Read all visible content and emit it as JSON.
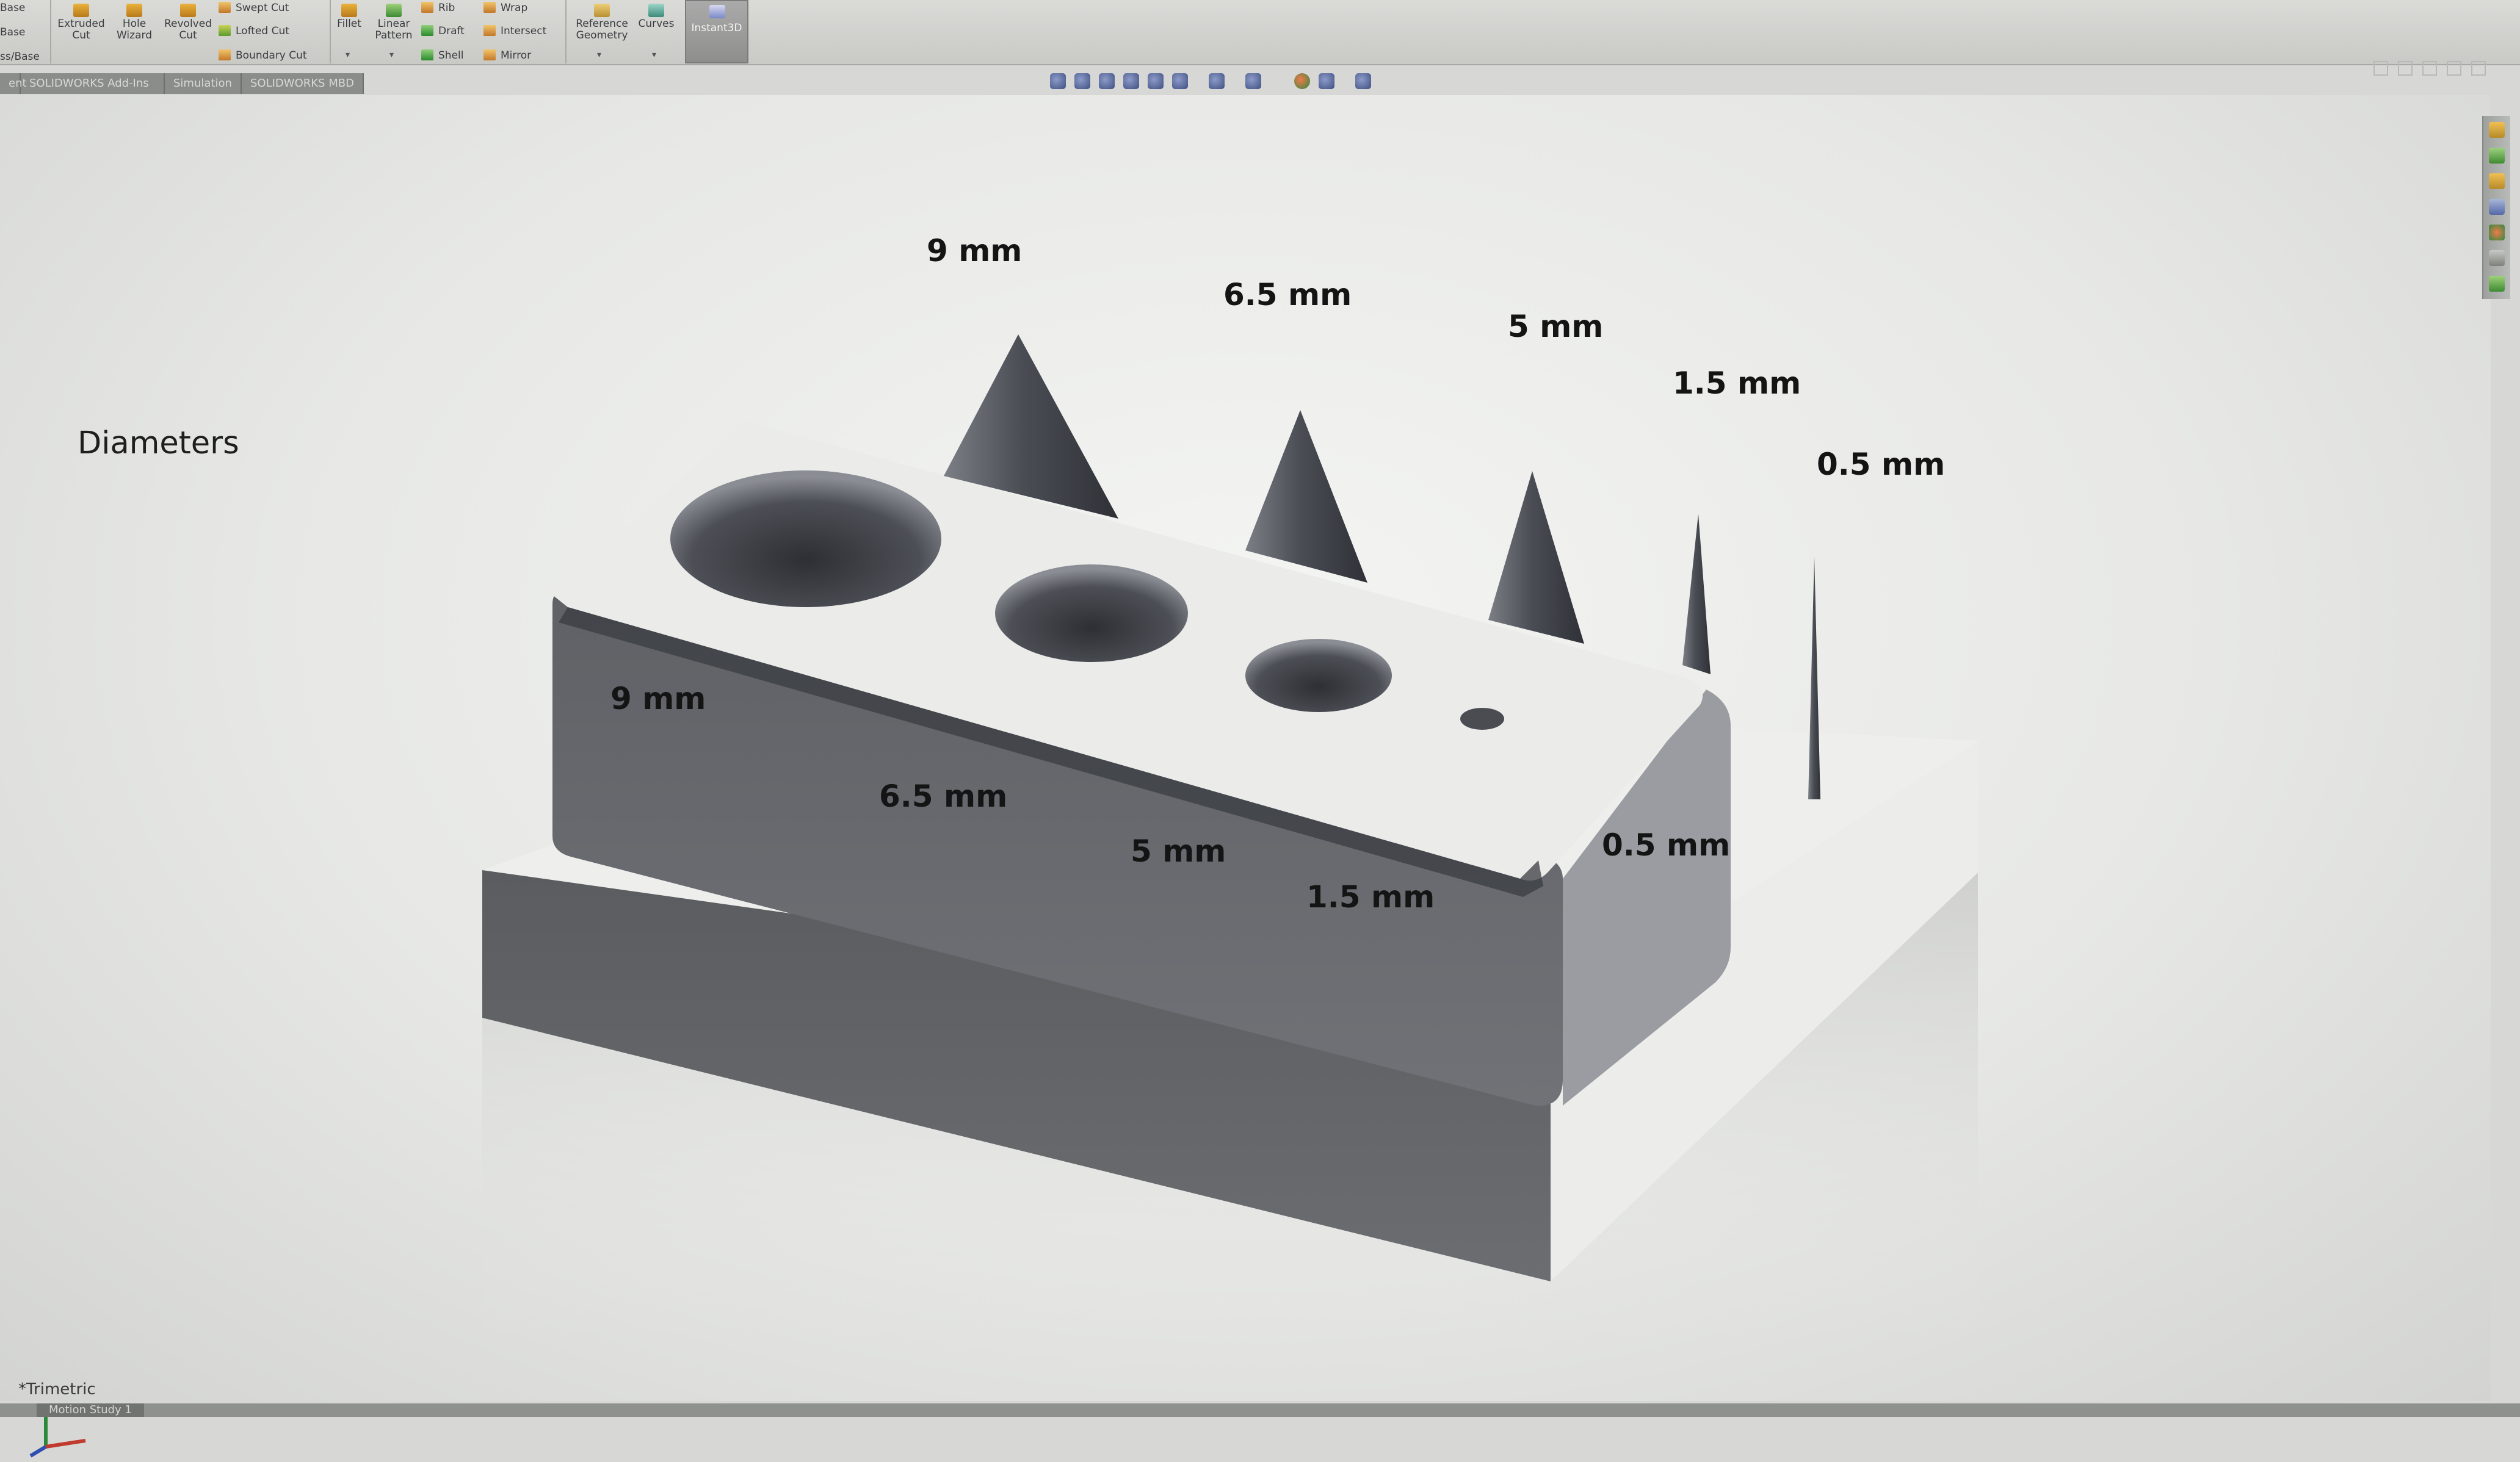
{
  "ribbon": {
    "left_cut": [
      "Base",
      "Base",
      "ss/Base"
    ],
    "features": {
      "extruded_cut": "Extruded Cut",
      "hole_wizard": "Hole Wizard",
      "revolved_cut": "Revolved Cut",
      "swept_cut": "Swept Cut",
      "lofted_cut": "Lofted Cut",
      "boundary_cut": "Boundary Cut",
      "fillet": "Fillet",
      "linear_pattern": "Linear Pattern",
      "rib": "Rib",
      "draft": "Draft",
      "shell": "Shell",
      "wrap": "Wrap",
      "intersect": "Intersect",
      "mirror": "Mirror",
      "reference_geometry": "Reference Geometry",
      "curves": "Curves",
      "instant3d": "Instant3D"
    }
  },
  "tabs": [
    "ent",
    "SOLIDWORKS Add-Ins",
    "Simulation",
    "SOLIDWORKS MBD"
  ],
  "viewport": {
    "title": "Diameters",
    "cone_labels": [
      "9 mm",
      "6.5 mm",
      "5 mm",
      "1.5 mm",
      "0.5 mm"
    ],
    "hole_labels": [
      "9 mm",
      "6.5 mm",
      "5 mm",
      "1.5 mm",
      "0.5 mm"
    ],
    "view_name": "*Trimetric"
  },
  "status": {
    "tab": "Motion Study 1"
  },
  "colors": {
    "background": "#e7e8e6",
    "body_dark": "#5c5e63",
    "body_light": "#eeeeec",
    "ribbon": "#d2d3cf"
  },
  "icons": [
    "zoom-to-fit-icon",
    "zoom-area-icon",
    "previous-view-icon",
    "section-view-icon",
    "view-orientation-icon",
    "display-style-icon",
    "hide-show-icon",
    "appearance-icon",
    "scene-icon",
    "view-settings-icon"
  ]
}
